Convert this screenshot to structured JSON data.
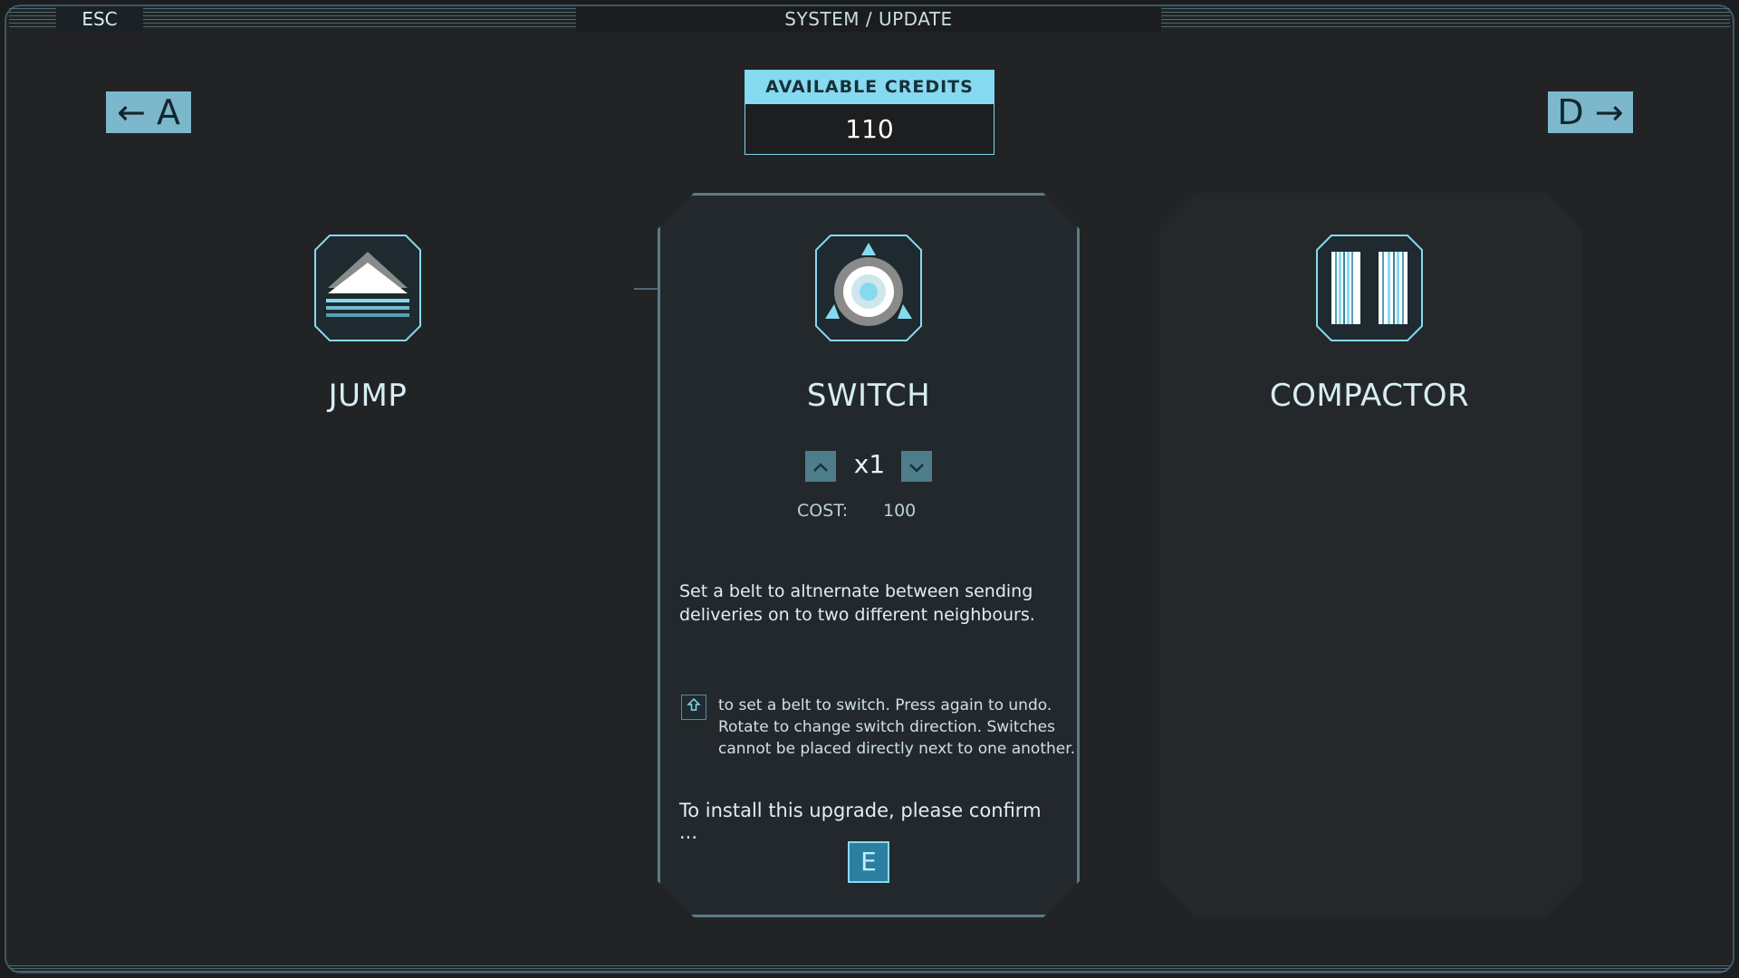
{
  "topbar": {
    "esc_label": "ESC",
    "title": "SYSTEM / UPDATE"
  },
  "nav": {
    "prev_label": "← A",
    "next_label": "D →"
  },
  "credits": {
    "header": "AVAILABLE CREDITS",
    "value": "110"
  },
  "upgrades": [
    {
      "name": "JUMP",
      "icon": "jump-icon"
    },
    {
      "name": "SWITCH",
      "icon": "switch-icon"
    },
    {
      "name": "COMPACTOR",
      "icon": "compactor-icon"
    }
  ],
  "selected": {
    "quantity": "x1",
    "increase_icon": "chevron-up-icon",
    "decrease_icon": "chevron-down-icon",
    "cost_label": "COST:",
    "cost_value": "100",
    "description": "Set a belt to altnernate between sending deliveries on to two different neighbours.",
    "hint_key_icon": "shift-key-icon",
    "hint": "to set a belt to switch. Press again to undo. Rotate to change switch direction. Switches cannot be placed directly next to one another.",
    "confirm_text": "To install this upgrade, please confirm ...",
    "confirm_key": "E"
  },
  "colors": {
    "accent": "#86daf0",
    "nav_button": "#7cb7cb",
    "border": "#5a7c86",
    "confirm_key_bg": "#2d7fa2"
  }
}
